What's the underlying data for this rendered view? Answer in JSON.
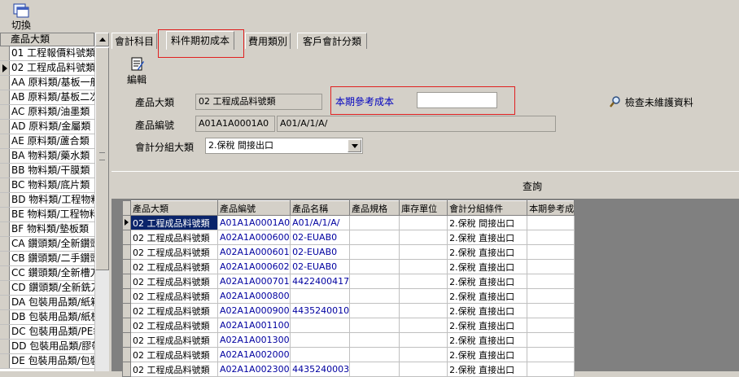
{
  "toolbar": {
    "switch_label": "切換"
  },
  "left_list": {
    "header": "產品大類",
    "items": [
      "01 工程報價料號類",
      "02 工程成品料號類",
      "AA 原料類/基板一般",
      "AB 原料類/基板二次",
      "AC 原料類/油墨類",
      "AD 原料類/金屬類",
      "AE 原料類/蘆合類",
      "BA 物料類/藥水類",
      "BB 物料類/干膜類",
      "BC 物料類/底片類",
      "BD 物料類/工程物料",
      "BE 物料類/工程物料",
      "BF 物料類/墊板類",
      "CA 鑽頭類/全新鑽頭",
      "CB 鑽頭類/二手鑽頭",
      "CC 鑽頭類/全新槽刀",
      "CD 鑽頭類/全新銑刀",
      "DA 包裝用品類/紙箱",
      "DB 包裝用品類/紙板",
      "DC 包裝用品類/PE袋",
      "DD 包裝用品類/膠帶",
      "DE 包裝用品類/包裝"
    ],
    "current_index": 1
  },
  "tabs": [
    {
      "label": "會計科目"
    },
    {
      "label": "料件期初成本"
    },
    {
      "label": "費用類別"
    },
    {
      "label": "客戶會計分類"
    }
  ],
  "form": {
    "edit_label": "編輯",
    "category_label": "產品大類",
    "category_value": "02 工程成品料號類",
    "cost_label": "本期參考成本",
    "cost_value": "",
    "product_no_label": "產品編號",
    "product_no_value": "A01A1A0001A0",
    "product_name_value": "A01/A/1/A/",
    "acct_group_label": "會計分組大類",
    "acct_group_value": "2.保稅 間接出口",
    "check_label": "檢查未維護資料"
  },
  "query": {
    "label": "查詢"
  },
  "grid": {
    "columns": [
      "產品大類",
      "產品編號",
      "產品名稱",
      "產品規格",
      "庫存單位",
      "會計分組條件",
      "本期參考成"
    ],
    "rows": [
      [
        "02 工程成品料號類",
        "A01A1A0001A0",
        "A01/A/1/A/",
        "",
        "",
        "2.保稅 間接出口",
        ""
      ],
      [
        "02 工程成品料號類",
        "A02A1A000600",
        "02-EUAB0",
        "",
        "",
        "2.保稅 直接出口",
        ""
      ],
      [
        "02 工程成品料號類",
        "A02A1A000601",
        "02-EUAB0",
        "",
        "",
        "2.保稅 直接出口",
        ""
      ],
      [
        "02 工程成品料號類",
        "A02A1A000602",
        "02-EUAB0",
        "",
        "",
        "2.保稅 直接出口",
        ""
      ],
      [
        "02 工程成品料號類",
        "A02A1A000701",
        "4422400417",
        "",
        "",
        "2.保稅 直接出口",
        ""
      ],
      [
        "02 工程成品料號類",
        "A02A1A000800",
        "",
        "",
        "",
        "2.保稅 直接出口",
        ""
      ],
      [
        "02 工程成品料號類",
        "A02A1A000900",
        "4435240010",
        "",
        "",
        "2.保稅 直接出口",
        ""
      ],
      [
        "02 工程成品料號類",
        "A02A1A001100",
        "",
        "",
        "",
        "2.保稅 直接出口",
        ""
      ],
      [
        "02 工程成品料號類",
        "A02A1A001300",
        "",
        "",
        "",
        "2.保稅 直接出口",
        ""
      ],
      [
        "02 工程成品料號類",
        "A02A1A002000",
        "",
        "",
        "",
        "2.保稅 直接出口",
        ""
      ],
      [
        "02 工程成品料號類",
        "A02A1A002300",
        "4435240003",
        "",
        "",
        "2.保稅 直接出口",
        ""
      ]
    ],
    "current_row": 0
  }
}
